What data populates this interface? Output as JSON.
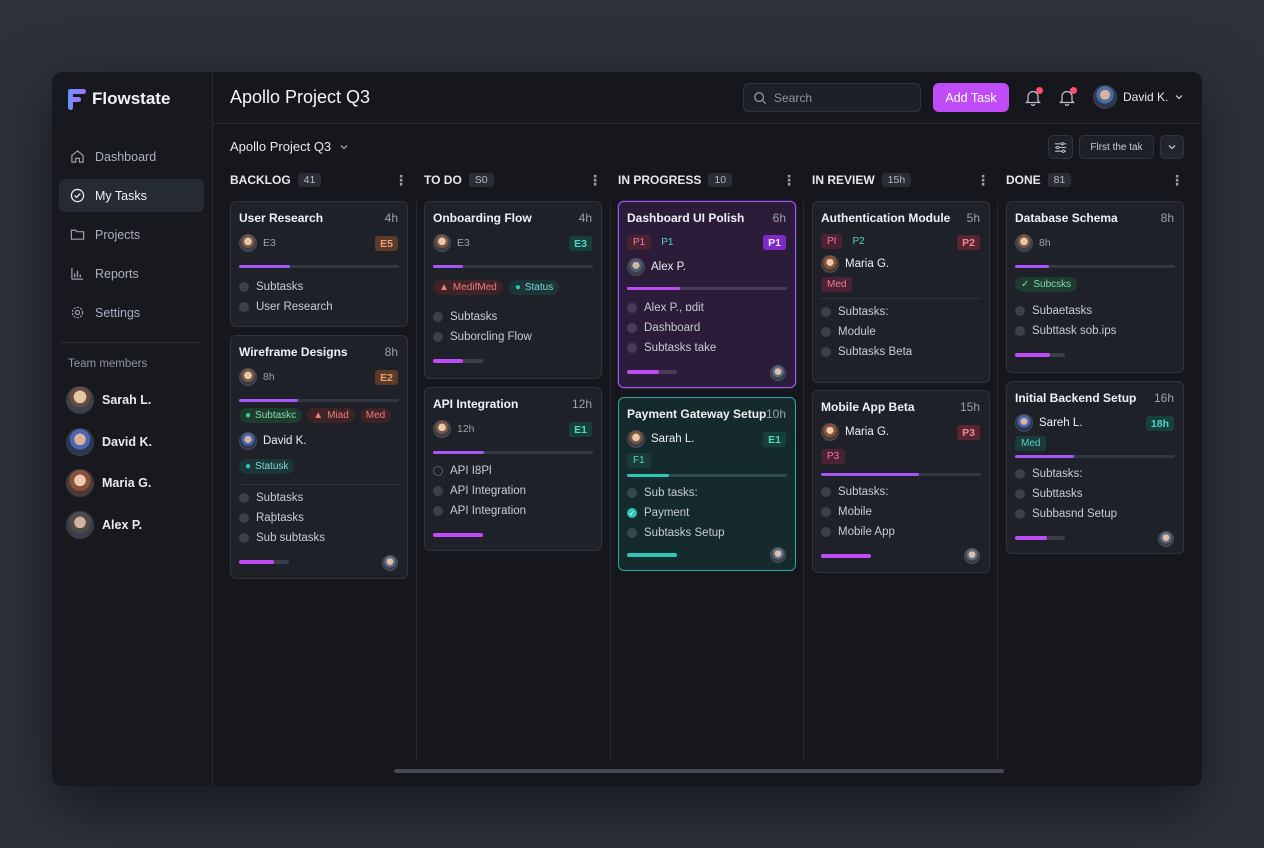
{
  "app": {
    "name": "Flowstate"
  },
  "nav": [
    {
      "label": "Dashboard",
      "icon": "home-icon"
    },
    {
      "label": "My Tasks",
      "icon": "check-circle-icon",
      "active": true
    },
    {
      "label": "Projects",
      "icon": "folder-icon"
    },
    {
      "label": "Reports",
      "icon": "chart-icon"
    },
    {
      "label": "Settings",
      "icon": "gear-icon"
    }
  ],
  "team": {
    "title": "Team members",
    "members": [
      "Sarah L.",
      "David K.",
      "Maria G.",
      "Alex P."
    ]
  },
  "header": {
    "title": "Apollo Project Q3",
    "search_placeholder": "Search",
    "add_task_label": "Add Task",
    "user_name": "David K."
  },
  "subbar": {
    "project": "Apollo Project Q3",
    "filter_label": "Flrst the tak"
  },
  "colors": {
    "accent": "#c04cf7",
    "teal": "#2ec4b6",
    "purple": "#a855f7",
    "danger": "#ff4d6a"
  },
  "columns": [
    {
      "title": "BACKLOG",
      "count": "41",
      "cards": [
        {
          "title": "User Research",
          "hours": "4h",
          "meta": "E3",
          "badge": "E5",
          "progress": 0.32,
          "subtasks": [
            "Subtasks",
            "User Research"
          ]
        },
        {
          "title": "Wireframe Designs",
          "hours": "8h",
          "meta": "8h",
          "badge": "E2",
          "progress": 0.37,
          "tags": [
            "Subtaskc",
            "Miad",
            "Med"
          ],
          "assignee": "David K.",
          "status": "Statusk",
          "subtasks": [
            "Subtasks",
            "Raþtasks",
            "Sub subtasks"
          ],
          "bar": 0.7
        }
      ]
    },
    {
      "title": "TO DO",
      "count": "S0",
      "cards": [
        {
          "title": "Onboarding Flow",
          "hours": "4h",
          "meta": "E3",
          "badge": "E3",
          "progress": 0.19,
          "tags": [
            "MedifMed",
            "Status"
          ],
          "subtasks": [
            "Subtasks",
            "Suborcling Flow"
          ],
          "bar": 0.6
        },
        {
          "title": "API Integration",
          "hours": "12h",
          "meta": "12h",
          "badge": "E1",
          "progress": 0.32,
          "subtasks": [
            "API I8Pl",
            "API Integration",
            "API Integration"
          ],
          "bar": 1.0
        }
      ]
    },
    {
      "title": "IN PROGRESS",
      "count": "10",
      "cards": [
        {
          "title": "Dashboard UI Polish",
          "hours": "6h",
          "prio": [
            "P1",
            "P1"
          ],
          "badge": "P1",
          "assignee": "Alex P.",
          "progress": 0.33,
          "subtasks": [
            "Alex P., ɒdit",
            "Dashboard",
            "Subtasks take"
          ],
          "bar": 0.64
        },
        {
          "title": "Payment Gateway Setup",
          "hours": "10h",
          "assignee": "Sarah L.",
          "badge": "E1",
          "prio": [
            "F1"
          ],
          "progress": 0.26,
          "subtasks": [
            "Sub tasks:",
            "Payment",
            "Subtasks Setup"
          ],
          "bar": 1.0
        }
      ]
    },
    {
      "title": "IN REVIEW",
      "count": "15h",
      "cards": [
        {
          "title": "Authentication Module",
          "hours": "5h",
          "prio": [
            "PI",
            "P2"
          ],
          "badge": "P2",
          "assignee": "Maria G.",
          "tags": [
            "Med"
          ],
          "subtasks": [
            "Subtasks:",
            "Module",
            "Subtasks Beta"
          ]
        },
        {
          "title": "Mobile App Beta",
          "hours": "15h",
          "assignee": "Maria G.",
          "badge": "P3",
          "prio": [
            "P3"
          ],
          "progress": 0.61,
          "subtasks": [
            "Subtasks:",
            "Mobile",
            "Mobile App"
          ],
          "bar": 1.0
        }
      ]
    },
    {
      "title": "DONE",
      "count": "81",
      "cards": [
        {
          "title": "Database Schema",
          "hours": "8h",
          "meta": "8h",
          "progress": 0.21,
          "tags": [
            "Subcsks"
          ],
          "subtasks": [
            "Subaetasks",
            "Subttask sob.ips"
          ],
          "bar": 0.7
        },
        {
          "title": "Initial Backend Setup",
          "hours": "16h",
          "assignee": "Sareh L.",
          "badge": "18h",
          "tags": [
            "Med"
          ],
          "progress": 0.37,
          "subtasks": [
            "Subtasks:",
            "Subttasks",
            "Subbasnd Setup"
          ],
          "bar": 0.64
        }
      ]
    }
  ]
}
